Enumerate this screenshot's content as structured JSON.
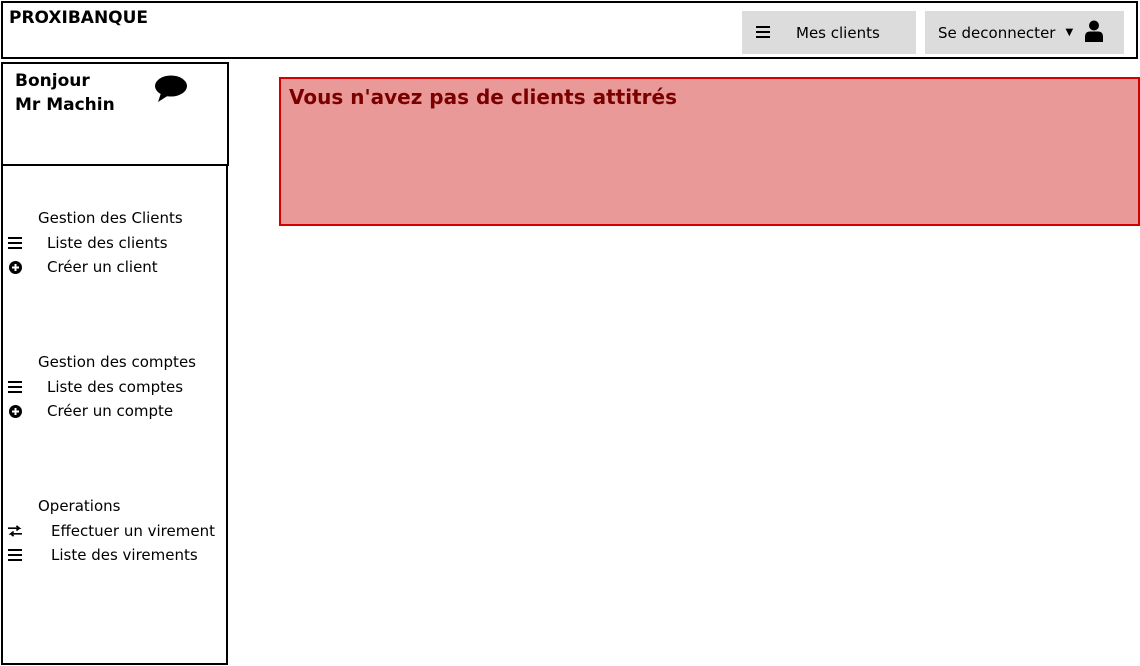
{
  "header": {
    "brand": "PROXIBANQUE",
    "clients_button": {
      "label": "Mes clients",
      "icon": "menu-icon"
    },
    "logout_button": {
      "label": "Se deconnecter",
      "icon": "user-icon"
    }
  },
  "greeting": {
    "line1": "Bonjour",
    "line2": "Mr Machin",
    "icon": "chat-bubble-icon"
  },
  "sidebar": {
    "sections": [
      {
        "title": "Gestion des Clients",
        "items": [
          {
            "label": "Liste des clients",
            "icon": "list-icon"
          },
          {
            "label": "Créer un client",
            "icon": "plus-circle-icon"
          }
        ]
      },
      {
        "title": "Gestion des comptes",
        "items": [
          {
            "label": "Liste des comptes",
            "icon": "list-icon"
          },
          {
            "label": "Créer un compte",
            "icon": "plus-circle-icon"
          }
        ]
      },
      {
        "title": "Operations",
        "items": [
          {
            "label": "Effectuer un virement",
            "icon": "transfer-icon"
          },
          {
            "label": "Liste des virements",
            "icon": "list-icon"
          }
        ]
      }
    ]
  },
  "alert": {
    "message": "Vous n'avez pas de clients attitrés",
    "background": "#ea9999",
    "border": "#d40000",
    "text_color": "#7a0000"
  }
}
